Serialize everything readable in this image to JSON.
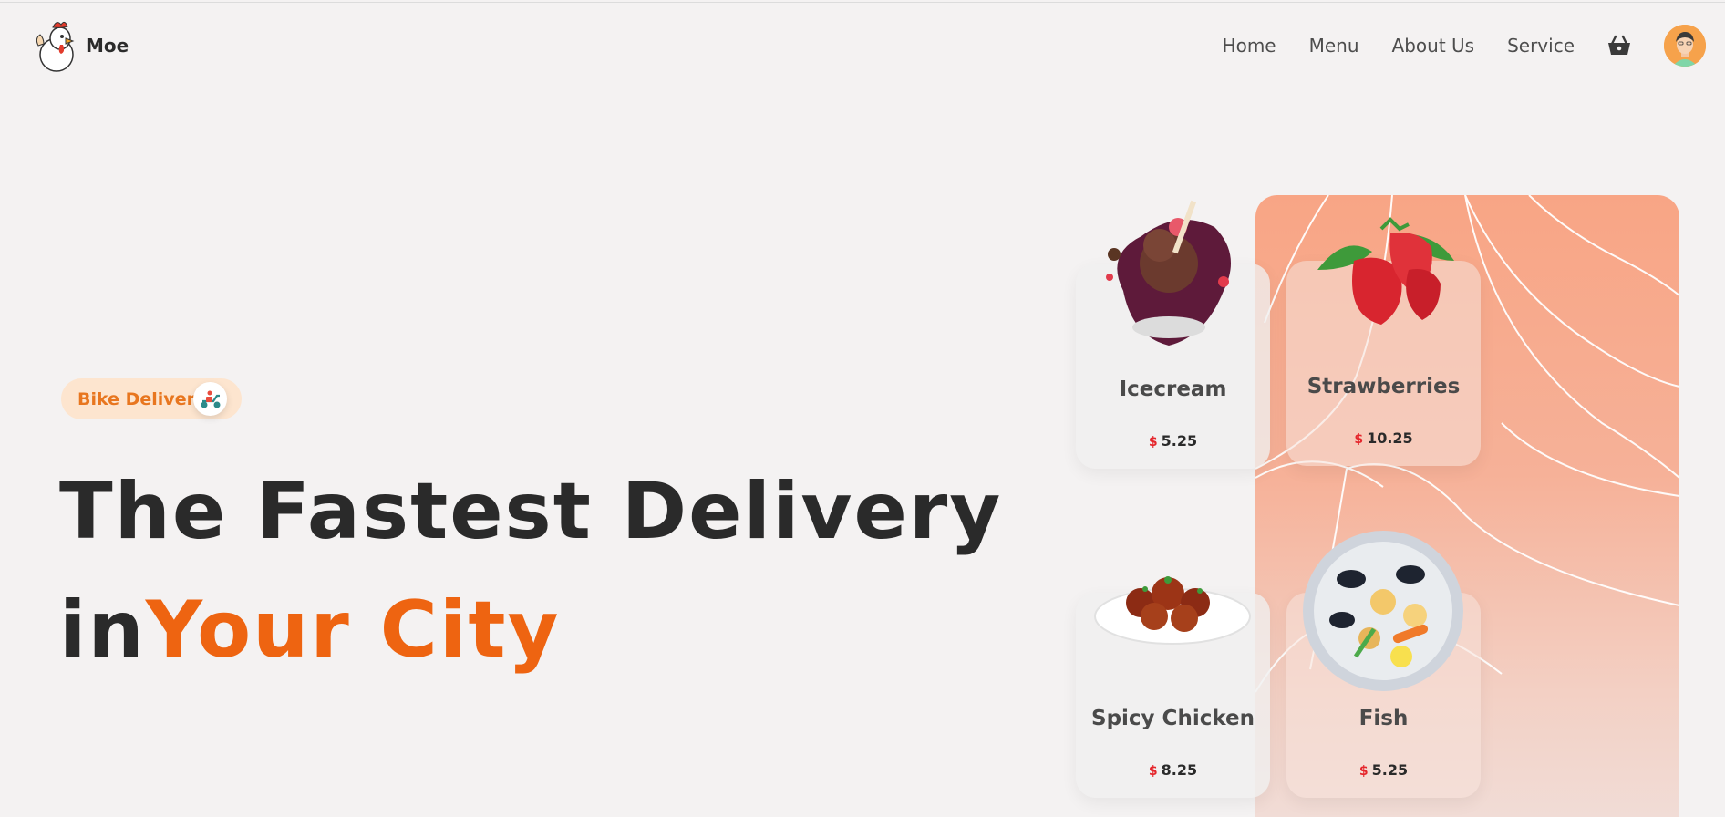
{
  "brand": {
    "name": "Moe"
  },
  "nav": {
    "items": [
      "Home",
      "Menu",
      "About Us",
      "Service"
    ]
  },
  "icons": {
    "cart": "basket-icon",
    "avatar": "user-avatar",
    "logo": "chicken-logo",
    "badge": "scooter-icon"
  },
  "colors": {
    "accent": "#ee6411",
    "badge_bg": "#fde5cf",
    "badge_text": "#e8761f",
    "price_currency": "#e5262c",
    "panel": "#f8a585"
  },
  "hero": {
    "badge_label": "Bike Delivery",
    "headline_line1": "The Fastest Delivery",
    "headline_line2_plain": "in",
    "headline_line2_accent": "Your City"
  },
  "menu": {
    "items": [
      {
        "name": "Icecream",
        "currency": "$",
        "price": "5.25"
      },
      {
        "name": "Strawberries",
        "currency": "$",
        "price": "10.25"
      },
      {
        "name": "Spicy Chicken",
        "currency": "$",
        "price": "8.25"
      },
      {
        "name": "Fish",
        "currency": "$",
        "price": "5.25"
      }
    ]
  }
}
